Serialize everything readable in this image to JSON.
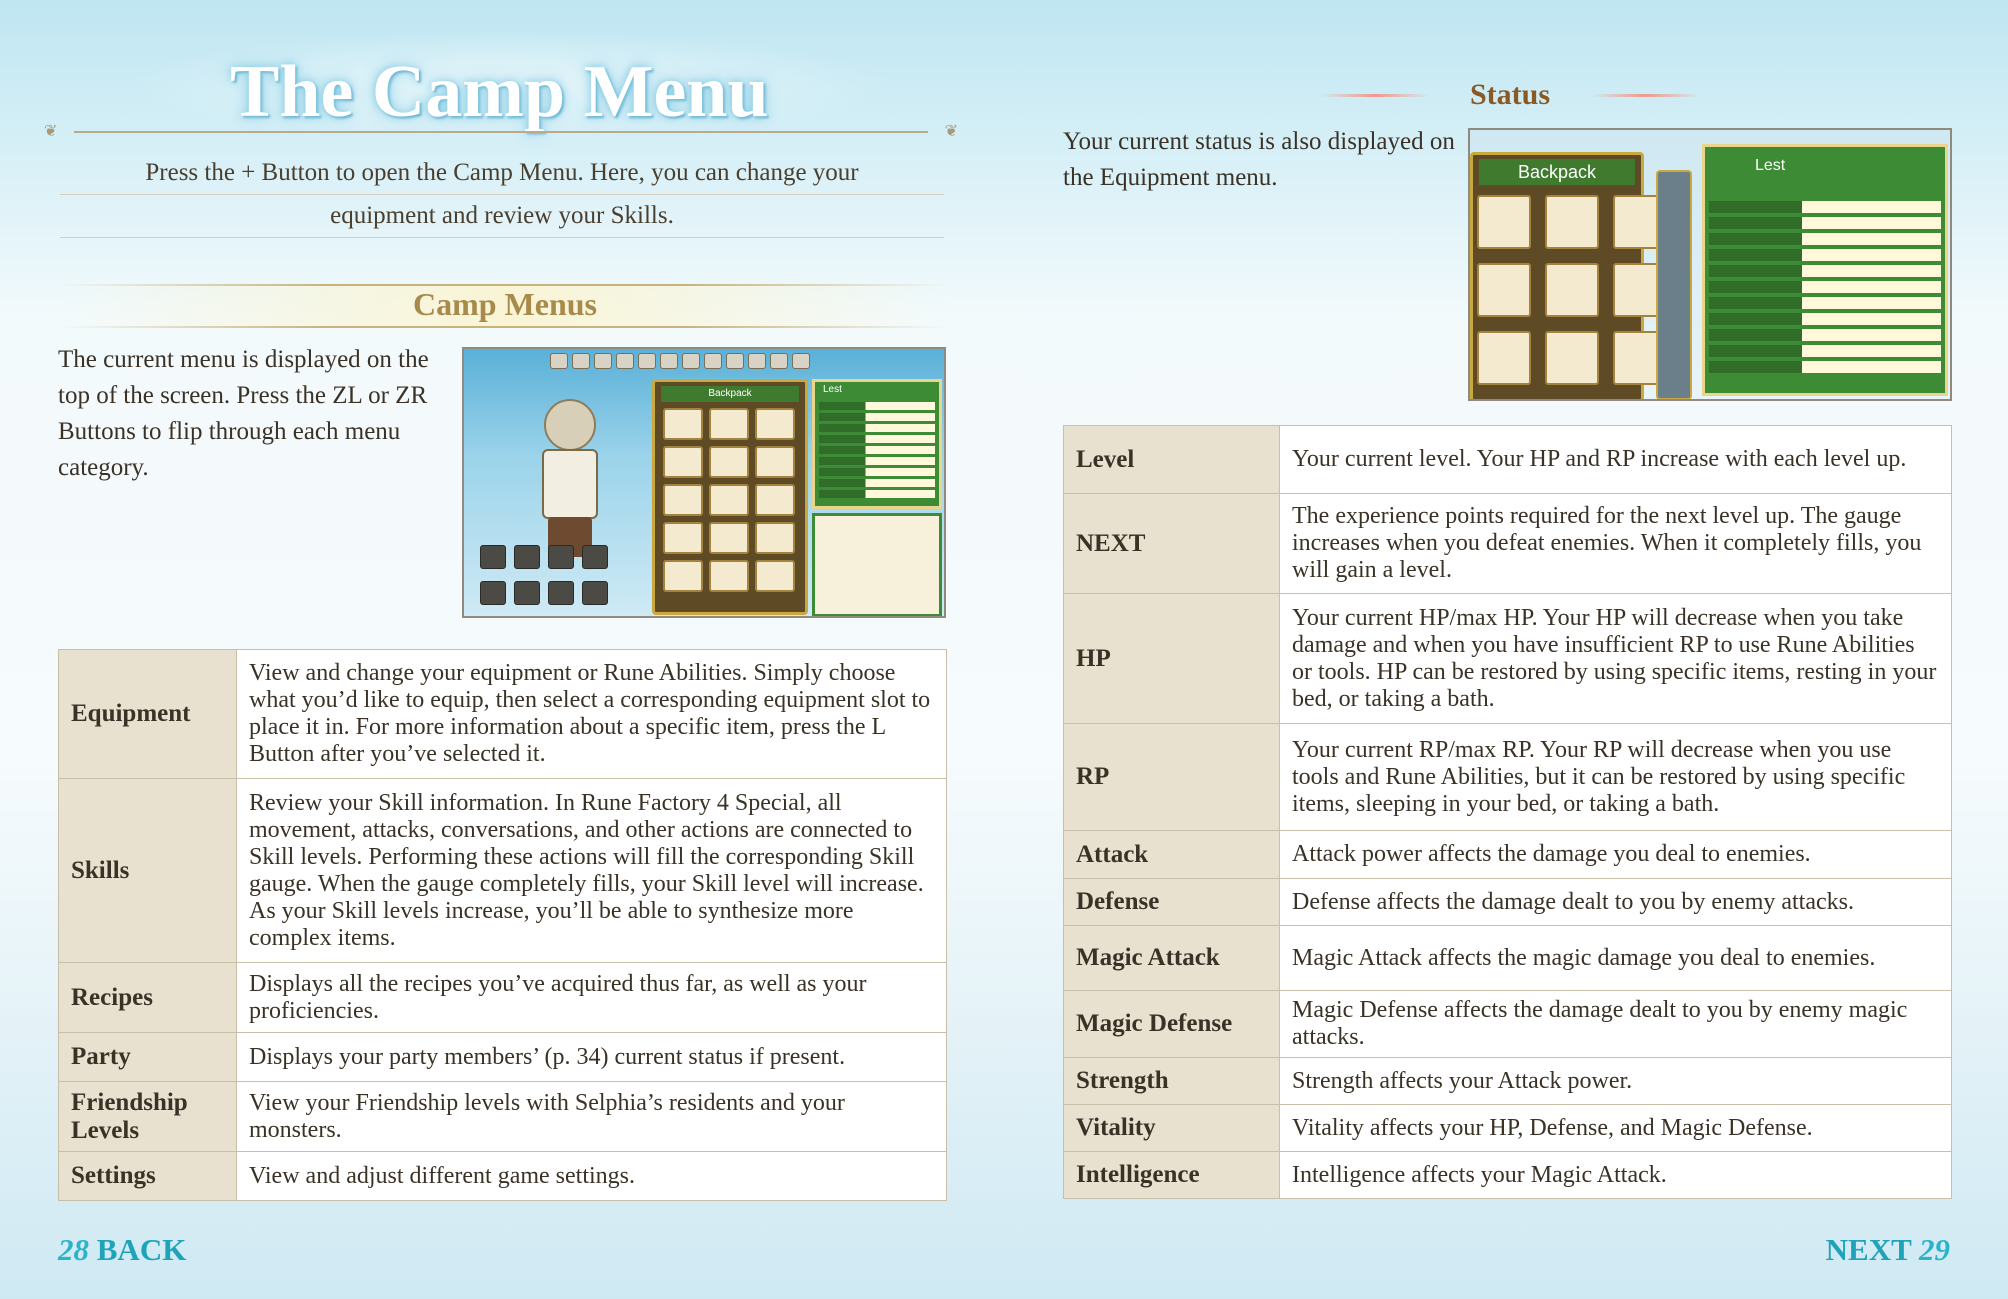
{
  "left": {
    "title": "The Camp Menu",
    "intro_line1": "Press the + Button to open the Camp Menu. Here, you can change your",
    "intro_line2": "equipment and review your Skills.",
    "section_title": "Camp Menus",
    "section_desc": "The current menu is displayed on the top of the screen. Press the ZL or ZR Buttons to flip through each menu category.",
    "screenshot": {
      "panel_title": "Backpack",
      "status_name": "Lest"
    },
    "table": [
      {
        "key": "Equipment",
        "value": "View and change your equipment or Rune Abilities. Simply choose what you’d like to equip, then select a corresponding equipment slot to place it in. For more information about a specific item, press the L Button after you’ve selected it."
      },
      {
        "key": "Skills",
        "value": "Review your Skill information. In Rune Factory 4 Special, all movement, attacks, conversations, and other actions are connected to Skill levels. Performing these actions will fill the corresponding Skill gauge. When the gauge completely fills, your Skill level will increase. As your Skill levels increase, you’ll be able to synthesize more complex items."
      },
      {
        "key": "Recipes",
        "value": "Displays all the recipes you’ve acquired thus far, as well as your proficiencies."
      },
      {
        "key": "Party",
        "value": "Displays your party members’ (p. 34) current status if present."
      },
      {
        "key": "Friendship Levels",
        "value": "View your Friendship levels with Selphia’s residents and your monsters."
      },
      {
        "key": "Settings",
        "value": "View and adjust different game settings."
      }
    ],
    "nav_page": "28",
    "nav_label": "BACK"
  },
  "right": {
    "section_title": "Status",
    "section_desc": "Your current status is also displayed on the Equipment menu.",
    "screenshot": {
      "panel_title": "Backpack",
      "status_name": "Lest"
    },
    "table": [
      {
        "key": "Level",
        "value": "Your current level. Your HP and RP increase with each level up."
      },
      {
        "key": "NEXT",
        "value": "The experience points required for the next level up. The gauge increases when you defeat enemies. When it completely fills, you will gain a level."
      },
      {
        "key": "HP",
        "value": "Your current HP/max HP. Your HP will decrease when you take damage and when you have insufficient RP to use Rune Abilities or tools. HP can be restored by using specific items, resting in your bed, or taking a bath."
      },
      {
        "key": "RP",
        "value": "Your current RP/max RP. Your RP will decrease when you use tools and Rune Abilities, but it can be restored by using specific items, sleeping in your bed, or taking a bath."
      },
      {
        "key": "Attack",
        "value": "Attack power affects the damage you deal to enemies."
      },
      {
        "key": "Defense",
        "value": "Defense affects the damage dealt to you by enemy attacks."
      },
      {
        "key": "Magic Attack",
        "value": "Magic Attack affects the magic damage you deal to enemies."
      },
      {
        "key": "Magic Defense",
        "value": "Magic Defense affects the damage dealt to you by enemy magic attacks."
      },
      {
        "key": "Strength",
        "value": "Strength affects your Attack power."
      },
      {
        "key": "Vitality",
        "value": "Vitality affects your HP, Defense, and Magic Defense."
      },
      {
        "key": "Intelligence",
        "value": "Intelligence affects your Magic Attack."
      }
    ],
    "nav_label": "NEXT",
    "nav_page": "29"
  },
  "colors": {
    "accent": "#1fa3b8",
    "header_gold": "#a88a4a",
    "status_brown": "#8a5a26",
    "key_cell": "#e9e1d0"
  }
}
